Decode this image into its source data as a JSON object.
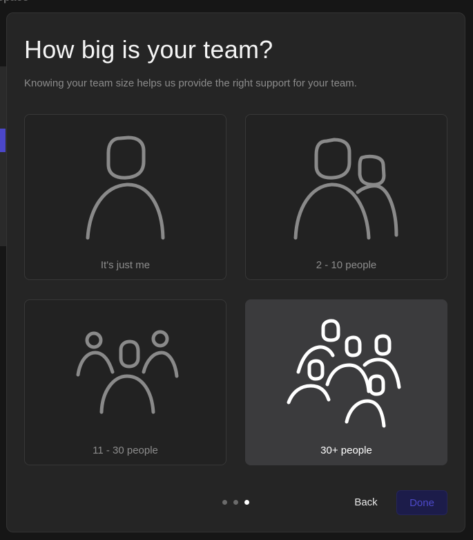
{
  "background": {
    "partial_text": "space"
  },
  "dialog": {
    "title": "How big is your team?",
    "subtitle": "Knowing your team size helps us provide the right support for your team.",
    "options": [
      {
        "label": "It's just me",
        "icon": "single-person-icon",
        "selected": false
      },
      {
        "label": "2 - 10 people",
        "icon": "two-people-icon",
        "selected": false
      },
      {
        "label": "11 - 30 people",
        "icon": "small-group-icon",
        "selected": false
      },
      {
        "label": "30+ people",
        "icon": "large-group-icon",
        "selected": true
      }
    ],
    "pagination": {
      "total": 3,
      "current": 3
    },
    "back_label": "Back",
    "done_label": "Done"
  },
  "colors": {
    "dialog_bg": "#252525",
    "selected_card_bg": "#3b3b3d",
    "accent": "#4d49c9",
    "done_bg": "#1c1c4a"
  }
}
